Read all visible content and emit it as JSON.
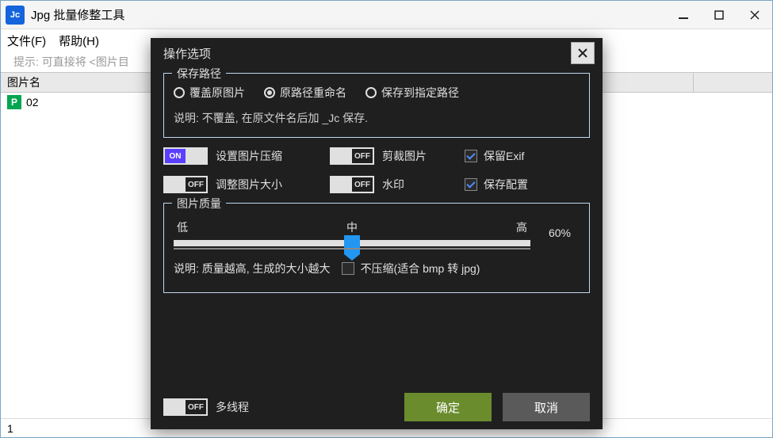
{
  "window": {
    "app_icon_text": "Jc",
    "title": "Jpg 批量修整工具"
  },
  "menu": {
    "file": "文件(F)",
    "help": "帮助(H)"
  },
  "hint": "提示: 可直接将 <图片目",
  "table": {
    "col_name": "图片名"
  },
  "files": [
    {
      "badge": "P",
      "name": "02"
    }
  ],
  "status": {
    "count": "1"
  },
  "dialog": {
    "title": "操作选项",
    "save_path": {
      "legend": "保存路径",
      "opt_overwrite": "覆盖原图片",
      "opt_rename": "原路径重命名",
      "opt_target": "保存到指定路径",
      "selected": "rename",
      "desc": "说明: 不覆盖, 在原文件名后加 _Jc 保存."
    },
    "toggles": {
      "on_text": "ON",
      "off_text": "OFF",
      "compress": {
        "state": "on",
        "label": "设置图片压缩"
      },
      "crop": {
        "state": "off",
        "label": "剪裁图片"
      },
      "resize": {
        "state": "off",
        "label": "调整图片大小"
      },
      "watermark": {
        "state": "off",
        "label": "水印"
      },
      "multithread": {
        "state": "off",
        "label": "多线程"
      }
    },
    "checks": {
      "keep_exif": {
        "checked": true,
        "label": "保留Exif"
      },
      "save_config": {
        "checked": true,
        "label": "保存配置"
      },
      "no_compress": {
        "checked": false,
        "label": "不压缩(适合 bmp 转 jpg)"
      }
    },
    "quality": {
      "legend": "图片质量",
      "low": "低",
      "mid": "中",
      "high": "高",
      "value": 60,
      "value_text": "60%",
      "desc": "说明: 质量越高, 生成的大小越大"
    },
    "buttons": {
      "ok": "确定",
      "cancel": "取消"
    }
  }
}
